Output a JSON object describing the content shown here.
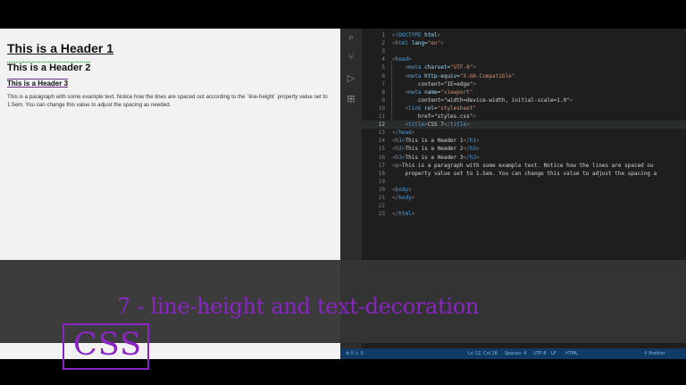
{
  "preview": {
    "h1": "This is a Header 1",
    "h2": "This is a Header 2",
    "h3": "This is a Header 3",
    "paragraph": "This is a paragraph with some example text. Notice how the lines are spaced out according to the `line-height` property value set to 1.5em. You can change this value to adjust the spacing as needed."
  },
  "activity_icons": [
    "search-icon",
    "source-control-icon",
    "run-debug-icon",
    "extensions-icon",
    "account-icon"
  ],
  "editor": {
    "active_line": 12,
    "lines": [
      {
        "n": "1",
        "code": "<!DOCTYPE html>"
      },
      {
        "n": "2",
        "code": "<html lang=\"en\">"
      },
      {
        "n": "3",
        "code": ""
      },
      {
        "n": "4",
        "code": "<head>"
      },
      {
        "n": "5",
        "code": "    <meta charset=\"UTF-8\">"
      },
      {
        "n": "6",
        "code": "    <meta http-equiv=\"X-UA-Compatible\""
      },
      {
        "n": "7",
        "code": "        content=\"IE=edge\">"
      },
      {
        "n": "8",
        "code": "    <meta name=\"viewport\""
      },
      {
        "n": "9",
        "code": "        content=\"width=device-width, initial-scale=1.0\">"
      },
      {
        "n": "10",
        "code": "    <link rel=\"stylesheet\""
      },
      {
        "n": "11",
        "code": "        href=\"styles.css\">"
      },
      {
        "n": "12",
        "code": "    <title>CSS 7</title>"
      },
      {
        "n": "13",
        "code": "</head>"
      },
      {
        "n": "14",
        "code": "<h1>This is a Header 1</h1>"
      },
      {
        "n": "15",
        "code": "<h2>This is a Header 2</h2>"
      },
      {
        "n": "16",
        "code": "<h3>This is a Header 3</h3>"
      },
      {
        "n": "17",
        "code": "<p>This is a paragraph with some example text. Notice how the lines are spaced ou"
      },
      {
        "n": "18",
        "code": "    property value set to 1.5em. You can change this value to adjust the spacing a"
      },
      {
        "n": "19",
        "code": ""
      },
      {
        "n": "20",
        "code": "<body>"
      },
      {
        "n": "21",
        "code": "</body>"
      },
      {
        "n": "22",
        "code": ""
      },
      {
        "n": "23",
        "code": "</html>"
      }
    ]
  },
  "statusbar": {
    "left": "⊗ 0 ⚠ 0",
    "position": "Ln 12, Col 16",
    "spaces": "Spaces: 4",
    "encoding": "UTF-8",
    "eol": "LF",
    "language": "HTML",
    "extra": "⚲ Prettier"
  },
  "overlay": {
    "title": "7 - line-height and text-decoration",
    "badge": "CSS"
  },
  "colors": {
    "accent": "#8b24c4",
    "tag": "#569cd6",
    "attr": "#9cdcfe",
    "string": "#ce9178",
    "text": "#d4d4d4"
  }
}
